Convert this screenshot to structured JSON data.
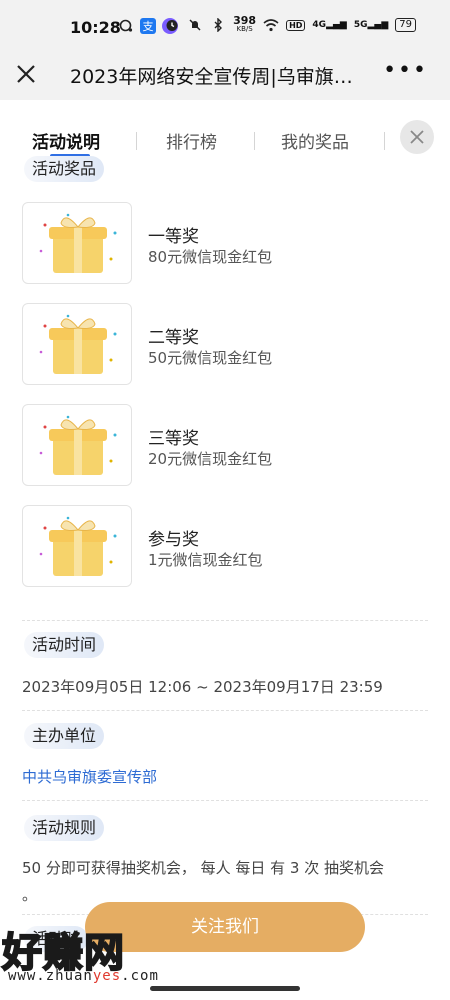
{
  "status_bar": {
    "time": "10:28",
    "net_speed_value": "398",
    "net_speed_unit": "KB/S",
    "hd_label": "HD",
    "signal1": "4G",
    "signal2": "5G",
    "battery": "79",
    "alipay_glyph": "支"
  },
  "title_bar": {
    "title": "2023年网络安全宣传周|乌审旗…",
    "more_label": "•••"
  },
  "tabs": [
    {
      "label": "活动说明",
      "active": true
    },
    {
      "label": "排行榜",
      "active": false
    },
    {
      "label": "我的奖品",
      "active": false
    }
  ],
  "prizes_section_title": "活动奖品",
  "prizes": [
    {
      "name": "一等奖",
      "desc": "80元微信现金红包"
    },
    {
      "name": "二等奖",
      "desc": "50元微信现金红包"
    },
    {
      "name": "三等奖",
      "desc": "20元微信现金红包"
    },
    {
      "name": "参与奖",
      "desc": "1元微信现金红包"
    }
  ],
  "time_section": {
    "title": "活动时间",
    "value": "2023年09月05日 12:06 ~ 2023年09月17日 23:59"
  },
  "organizer_section": {
    "title": "主办单位",
    "value": "中共乌审旗委宣传部"
  },
  "rules_section": {
    "title": "活动规则",
    "line1": "50 分即可获得抽奖机会， 每人 每日 有 3 次 抽奖机会",
    "line2": "。"
  },
  "partial_section_title": "活动时",
  "follow_button": "关注我们",
  "watermark": {
    "big": "好赚网",
    "small_prefix": "www.zhuan",
    "small_highlight": "yes",
    "small_suffix": ".com"
  },
  "colors": {
    "accent_blue": "#2f6fe4",
    "button_gold": "#e5ad63",
    "link_blue": "#2d6bd3"
  }
}
